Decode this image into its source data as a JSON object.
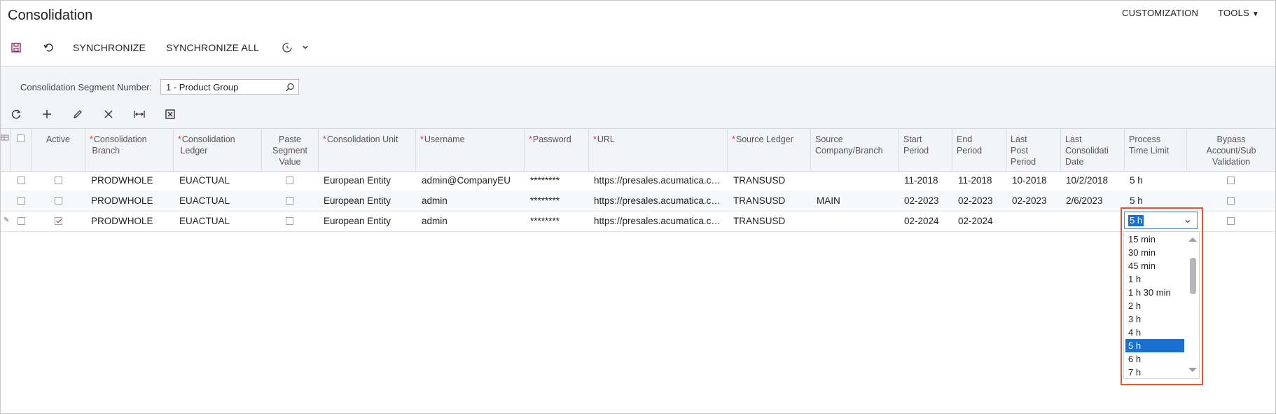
{
  "app": {
    "title": "Consolidation",
    "top_links": {
      "customization": "CUSTOMIZATION",
      "tools": "TOOLS"
    }
  },
  "toolbar": {
    "synchronize": "SYNCHRONIZE",
    "synchronize_all": "SYNCHRONIZE ALL",
    "icons": [
      "save-icon",
      "undo-icon",
      "schedule-icon",
      "chevron-down-icon"
    ]
  },
  "form": {
    "segment_label": "Consolidation Segment Number:",
    "segment_value": "1 - Product Group"
  },
  "grid_toolbar": {
    "icons": [
      "refresh-icon",
      "add-icon",
      "edit-icon",
      "delete-icon",
      "fit-columns-icon",
      "export-excel-icon"
    ]
  },
  "columns": {
    "active": "Active",
    "branch": [
      "Consolidation",
      "Branch"
    ],
    "ledger": [
      "Consolidation",
      "Ledger"
    ],
    "paste": [
      "Paste",
      "Segment",
      "Value"
    ],
    "unit": "Consolidation Unit",
    "username": "Username",
    "password": "Password",
    "url": "URL",
    "source_ledger": "Source Ledger",
    "source_company": [
      "Source",
      "Company/Branch"
    ],
    "start_period": [
      "Start",
      "Period"
    ],
    "end_period": [
      "End",
      "Period"
    ],
    "last_post": [
      "Last",
      "Post",
      "Period"
    ],
    "last_consol": [
      "Last",
      "Consolidati",
      "Date"
    ],
    "process_time": [
      "Process",
      "Time Limit"
    ],
    "bypass": [
      "Bypass",
      "Account/Sub",
      "Validation"
    ]
  },
  "rows": [
    {
      "active": false,
      "branch": "PRODWHOLE",
      "ledger": "EUACTUAL",
      "paste": false,
      "unit": "European Entity",
      "username": "admin@CompanyEU",
      "password": "********",
      "url": "https://presales.acumatica.co...",
      "source_ledger": "TRANSUSD",
      "source_company": "",
      "start": "11-2018",
      "end": "11-2018",
      "last_post": "10-2018",
      "last_consol": "10/2/2018",
      "process_time": "5 h",
      "bypass": false
    },
    {
      "active": false,
      "branch": "PRODWHOLE",
      "ledger": "EUACTUAL",
      "paste": false,
      "unit": "European Entity",
      "username": "admin",
      "password": "********",
      "url": "https://presales.acumatica.co...",
      "source_ledger": "TRANSUSD",
      "source_company": "MAIN",
      "start": "02-2023",
      "end": "02-2023",
      "last_post": "02-2023",
      "last_consol": "2/6/2023",
      "process_time": "5 h",
      "bypass": false
    },
    {
      "active": true,
      "branch": "PRODWHOLE",
      "ledger": "EUACTUAL",
      "paste": false,
      "unit": "European Entity",
      "username": "admin",
      "password": "********",
      "url": "https://presales.acumatica.co...",
      "source_ledger": "TRANSUSD",
      "source_company": "",
      "start": "02-2024",
      "end": "02-2024",
      "last_post": "",
      "last_consol": "",
      "process_time": "5 h",
      "bypass": false
    }
  ],
  "dropdown": {
    "selected": "5 h",
    "options": [
      "15 min",
      "30 min",
      "45 min",
      "1 h",
      "1 h 30 min",
      "2 h",
      "3 h",
      "4 h",
      "5 h",
      "6 h",
      "7 h"
    ]
  },
  "colors": {
    "accent": "#1a6fd1",
    "required": "#e03a3a",
    "highlight_box": "#e5533a",
    "header_bg": "#f3f4f7"
  }
}
